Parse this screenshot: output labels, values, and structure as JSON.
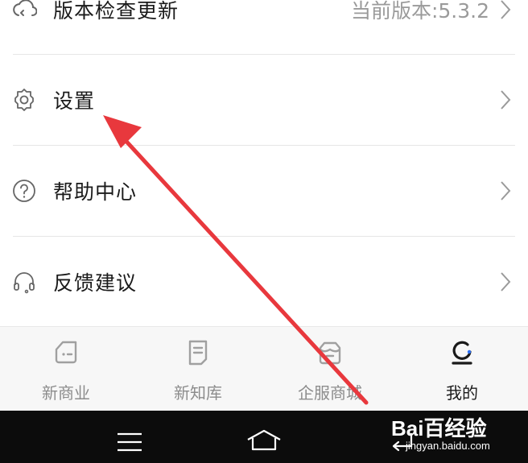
{
  "menu": {
    "items": [
      {
        "label": "版本检查更新",
        "value": "当前版本:5.3.2",
        "icon": "cloud-refresh-icon"
      },
      {
        "label": "设置",
        "value": "",
        "icon": "gear-icon"
      },
      {
        "label": "帮助中心",
        "value": "",
        "icon": "help-circle-icon"
      },
      {
        "label": "反馈建议",
        "value": "",
        "icon": "headset-icon"
      }
    ]
  },
  "tabbar": {
    "tabs": [
      {
        "label": "新商业",
        "icon": "business-icon",
        "active": false
      },
      {
        "label": "新知库",
        "icon": "document-icon",
        "active": false
      },
      {
        "label": "企服商城",
        "icon": "shop-icon",
        "active": false
      },
      {
        "label": "我的",
        "icon": "profile-icon",
        "active": true
      }
    ]
  },
  "navbar": {
    "buttons": [
      "menu-icon",
      "home-icon",
      "back-icon"
    ]
  },
  "watermark": {
    "brand": "Bai百经验",
    "text": "经验",
    "url": "jingyan.baidu.com"
  },
  "colors": {
    "annotation_arrow": "#e8383d",
    "accent": "#1a1a1a",
    "inactive": "#8c8c8c"
  }
}
